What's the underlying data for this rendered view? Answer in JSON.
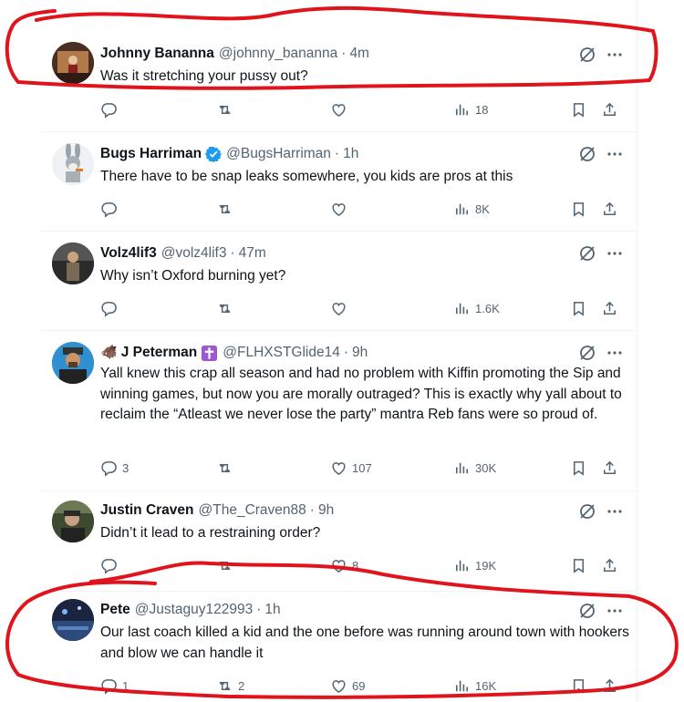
{
  "replies": [
    {
      "name": "Johnny Bananna",
      "verified": false,
      "emoji": "",
      "cross": false,
      "handle": "@johnny_bananna",
      "time": "4m",
      "text": "Was it stretching your pussy out?",
      "counts": {
        "reply": "",
        "retweet": "",
        "like": "",
        "views": "18"
      },
      "avatar_color": "#5a3b2a"
    },
    {
      "name": "Bugs Harriman",
      "verified": true,
      "emoji": "",
      "cross": false,
      "handle": "@BugsHarriman",
      "time": "1h",
      "text": "There have to be snap leaks somewhere, you kids are pros at this",
      "counts": {
        "reply": "",
        "retweet": "",
        "like": "",
        "views": "8K"
      },
      "avatar_color": "#e9eef2"
    },
    {
      "name": "Volz4lif3",
      "verified": false,
      "emoji": "",
      "cross": false,
      "handle": "@volz4lif3",
      "time": "47m",
      "text": "Why isn’t Oxford burning yet?",
      "counts": {
        "reply": "",
        "retweet": "",
        "like": "",
        "views": "1.6K"
      },
      "avatar_color": "#3b3b3b"
    },
    {
      "name": "J Peterman",
      "verified": false,
      "emoji": "🐗",
      "cross": true,
      "handle": "@FLHXSTGlide14",
      "time": "9h",
      "text": "Yall knew this crap all season and had no problem with Kiffin promoting the Sip and winning games, but now you are morally outraged? This is exactly why yall about to reclaim the “Atleast we never lose the party” mantra Reb fans were so proud of.",
      "counts": {
        "reply": "3",
        "retweet": "",
        "like": "107",
        "views": "30K"
      },
      "avatar_color": "#2a9fd6"
    },
    {
      "name": "Justin Craven",
      "verified": false,
      "emoji": "",
      "cross": false,
      "handle": "@The_Craven88",
      "time": "9h",
      "text": "Didn’t it lead to a restraining order?",
      "counts": {
        "reply": "",
        "retweet": "",
        "like": "8",
        "views": "19K"
      },
      "avatar_color": "#4a5a3a"
    },
    {
      "name": "Pete",
      "verified": false,
      "emoji": "",
      "cross": false,
      "handle": "@Justaguy122993",
      "time": "1h",
      "text": "Our last coach killed a kid and the one before was running around town with hookers and blow we can handle it",
      "counts": {
        "reply": "1",
        "retweet": "2",
        "like": "69",
        "views": "16K"
      },
      "avatar_color": "#1f2a44"
    }
  ],
  "colors": {
    "text": "#0f1419",
    "muted": "#536471",
    "verified": "#1d9bf0",
    "annotation": "#e0141c",
    "cross": "#9b59d0"
  }
}
